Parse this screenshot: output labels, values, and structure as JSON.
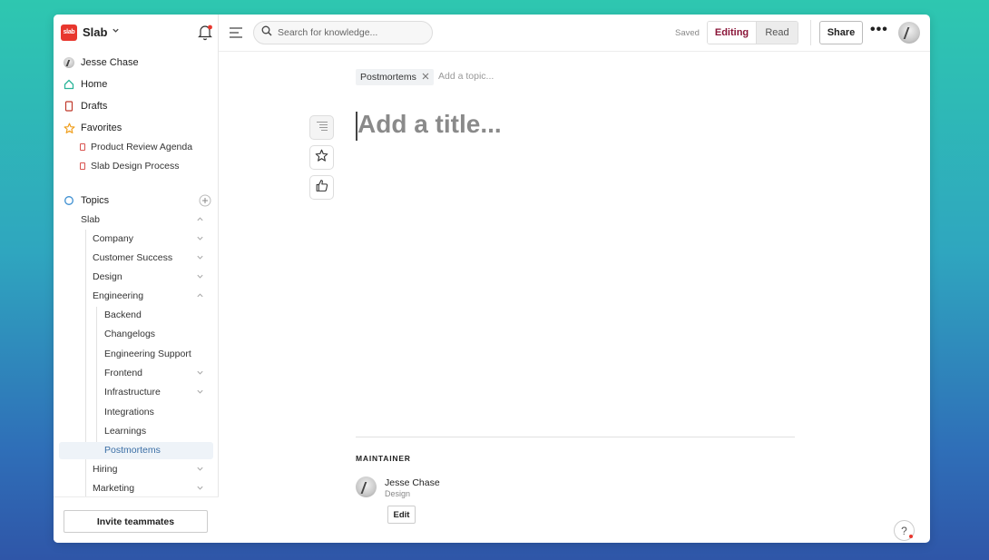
{
  "workspace": {
    "logo_text": "slab",
    "name": "Slab"
  },
  "sidebar": {
    "user": "Jesse Chase",
    "home": "Home",
    "drafts": "Drafts",
    "favorites": {
      "label": "Favorites",
      "items": [
        "Product Review Agenda",
        "Slab Design Process"
      ]
    },
    "topics": {
      "label": "Topics",
      "tree": [
        {
          "label": "Slab",
          "expanded": true
        },
        {
          "label": "Company"
        },
        {
          "label": "Customer Success"
        },
        {
          "label": "Design"
        },
        {
          "label": "Engineering",
          "expanded": true
        },
        {
          "label": "Backend"
        },
        {
          "label": "Changelogs"
        },
        {
          "label": "Engineering Support"
        },
        {
          "label": "Frontend"
        },
        {
          "label": "Infrastructure"
        },
        {
          "label": "Integrations"
        },
        {
          "label": "Learnings"
        },
        {
          "label": "Postmortems",
          "selected": true
        },
        {
          "label": "Hiring"
        },
        {
          "label": "Marketing"
        }
      ]
    },
    "invite_label": "Invite teammates"
  },
  "topbar": {
    "search_placeholder": "Search for knowledge...",
    "saved_label": "Saved",
    "mode_editing": "Editing",
    "mode_read": "Read",
    "share_label": "Share",
    "more_label": "•••"
  },
  "editor": {
    "topic_chip": "Postmortems",
    "add_topic_placeholder": "Add a topic...",
    "title_placeholder": "Add a title...",
    "maintainer_heading": "MAINTAINER",
    "maintainer": {
      "name": "Jesse Chase",
      "team": "Design"
    },
    "edit_label": "Edit",
    "help_label": "?"
  },
  "colors": {
    "brand": "#e8372e",
    "editing_accent": "#8a1538",
    "selected_row": "#eef3f8"
  },
  "icons": [
    "bell-icon",
    "home-icon",
    "drafts-icon",
    "star-icon",
    "topics-icon",
    "plus-icon",
    "chevron-icon",
    "menu-icon",
    "search-icon",
    "outline-icon",
    "thumbs-up-icon",
    "close-icon",
    "help-icon"
  ]
}
